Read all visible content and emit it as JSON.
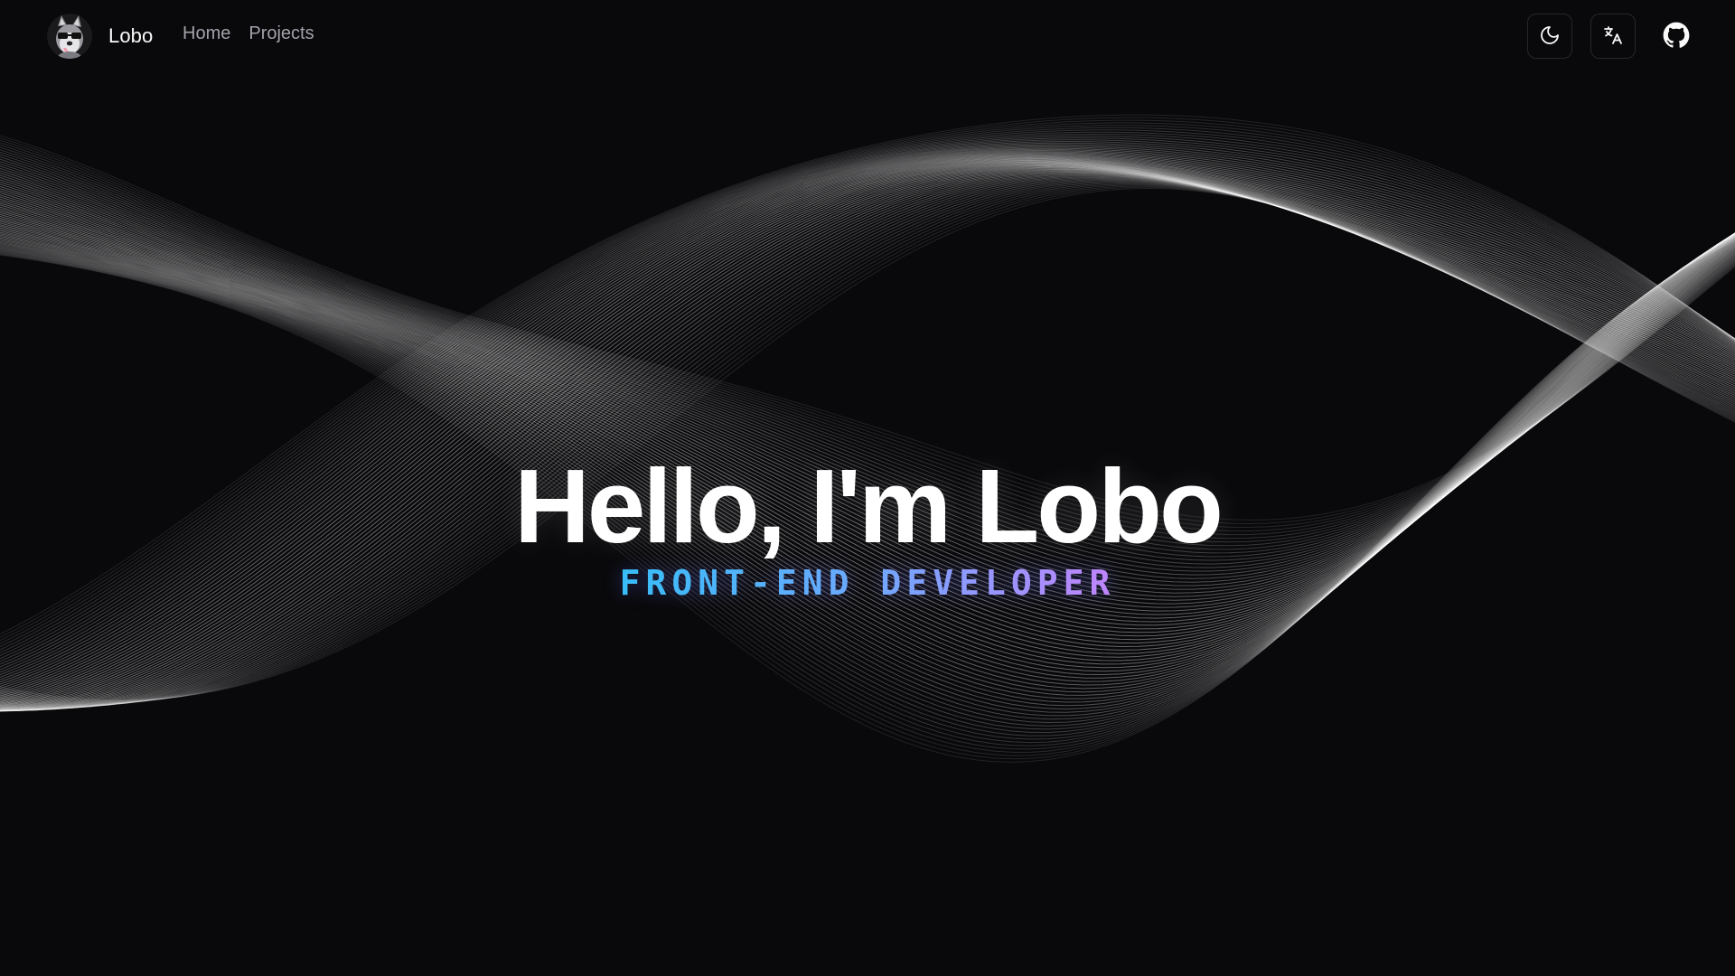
{
  "header": {
    "brand": {
      "name": "Lobo",
      "avatar_icon": "husky-sunglasses-avatar"
    },
    "nav": [
      {
        "label": "Home"
      },
      {
        "label": "Projects"
      }
    ],
    "actions": [
      {
        "icon": "moon-icon"
      },
      {
        "icon": "translate-icon"
      },
      {
        "icon": "github-icon"
      }
    ]
  },
  "hero": {
    "title": "Hello, I'm Lobo",
    "subtitle": "FRONT-END DEVELOPER"
  },
  "colors": {
    "background": "#09090b",
    "text": "#fafafa",
    "nav_text": "#a1a1aa",
    "border": "#27272a",
    "gradient_start": "#38bdf8",
    "gradient_mid": "#6ea8ff",
    "gradient_end": "#c084fc"
  }
}
